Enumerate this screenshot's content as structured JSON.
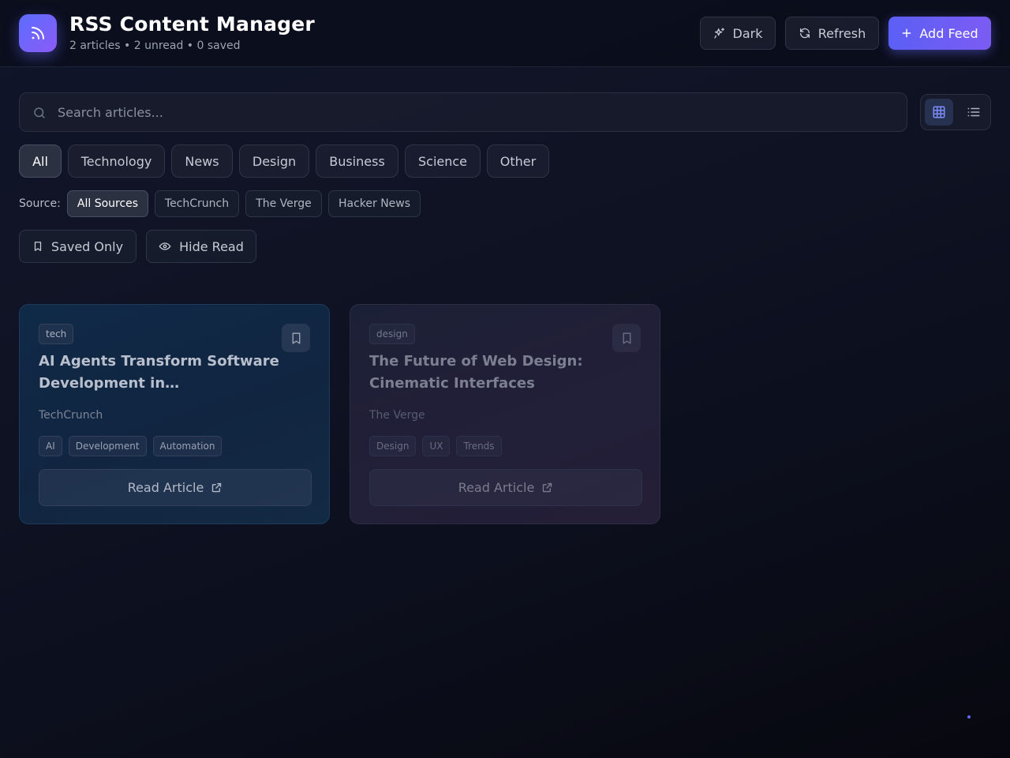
{
  "header": {
    "title": "RSS Content Manager",
    "subtitle": "2 articles • 2 unread • 0 saved",
    "logo_icon": "rss-icon",
    "buttons": {
      "theme_label": "Dark",
      "refresh_label": "Refresh",
      "add_feed_label": "Add Feed"
    }
  },
  "search": {
    "placeholder": "Search articles...",
    "value": ""
  },
  "view_toggle": {
    "active": "grid",
    "options": [
      "grid-icon",
      "list-icon"
    ]
  },
  "categories": {
    "active": "All",
    "items": [
      "All",
      "Technology",
      "News",
      "Design",
      "Business",
      "Science",
      "Other"
    ]
  },
  "sources": {
    "label": "Source:",
    "active": "All Sources",
    "items": [
      "All Sources",
      "TechCrunch",
      "The Verge",
      "Hacker News"
    ]
  },
  "filters": {
    "saved_only_label": "Saved Only",
    "hide_read_label": "Hide Read"
  },
  "articles": [
    {
      "category": "tech",
      "title": "AI Agents Transform Software Development in…",
      "source": "TechCrunch",
      "tags": [
        "AI",
        "Development",
        "Automation"
      ],
      "read_label": "Read Article",
      "saved": false
    },
    {
      "category": "design",
      "title": "The Future of Web Design: Cinematic Interfaces",
      "source": "The Verge",
      "tags": [
        "Design",
        "UX",
        "Trends"
      ],
      "read_label": "Read Article",
      "saved": false
    }
  ],
  "colors": {
    "accent": "#6366f1",
    "accent_secondary": "#8b5cf6",
    "background": "#0f1324"
  }
}
